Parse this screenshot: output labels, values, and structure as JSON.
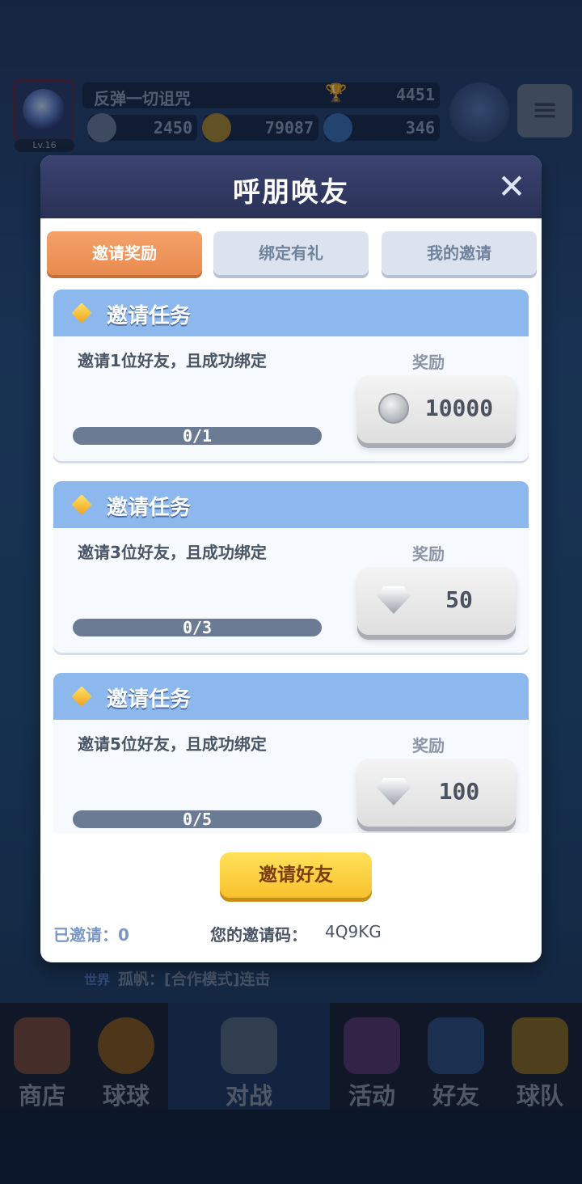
{
  "header": {
    "player_name": "反弹一切诅咒",
    "level": "Lv.16",
    "trophies": "4451",
    "resources": [
      "2450",
      "79087",
      "346"
    ]
  },
  "modal": {
    "title": "呼朋唤友",
    "close_symbol": "✕",
    "tabs": [
      {
        "label": "邀请奖励",
        "active": true
      },
      {
        "label": "绑定有礼",
        "active": false
      },
      {
        "label": "我的邀请",
        "active": false
      }
    ],
    "tasks": [
      {
        "title": "邀请任务",
        "description": "邀请1位好友，且成功绑定",
        "reward_label": "奖励",
        "reward_value": "10000",
        "reward_icon": "coin-icon",
        "progress": "0/1",
        "progress_fraction": 0
      },
      {
        "title": "邀请任务",
        "description": "邀请3位好友，且成功绑定",
        "reward_label": "奖励",
        "reward_value": "50",
        "reward_icon": "gem-icon",
        "progress": "0/3",
        "progress_fraction": 0
      },
      {
        "title": "邀请任务",
        "description": "邀请5位好友，且成功绑定",
        "reward_label": "奖励",
        "reward_value": "100",
        "reward_icon": "gem-icon",
        "progress": "0/5",
        "progress_fraction": 0
      }
    ],
    "invite_button": "邀请好友",
    "invited_count": "已邀请：0",
    "invite_code_label": "您的邀请码：",
    "invite_code": "4Q9KG"
  },
  "chat": {
    "channel": "世界",
    "message": "孤帆：[合作模式]连击"
  },
  "bottom_nav": [
    {
      "label": "商店",
      "active": false
    },
    {
      "label": "球球",
      "active": false
    },
    {
      "label": "对战",
      "active": true
    },
    {
      "label": "活动",
      "active": false
    },
    {
      "label": "好友",
      "active": false
    },
    {
      "label": "球队",
      "active": false
    }
  ],
  "colors": {
    "accent_orange": "#e98b4f",
    "task_header_blue": "#8cb8ed",
    "invite_yellow": "#f8c22d"
  }
}
